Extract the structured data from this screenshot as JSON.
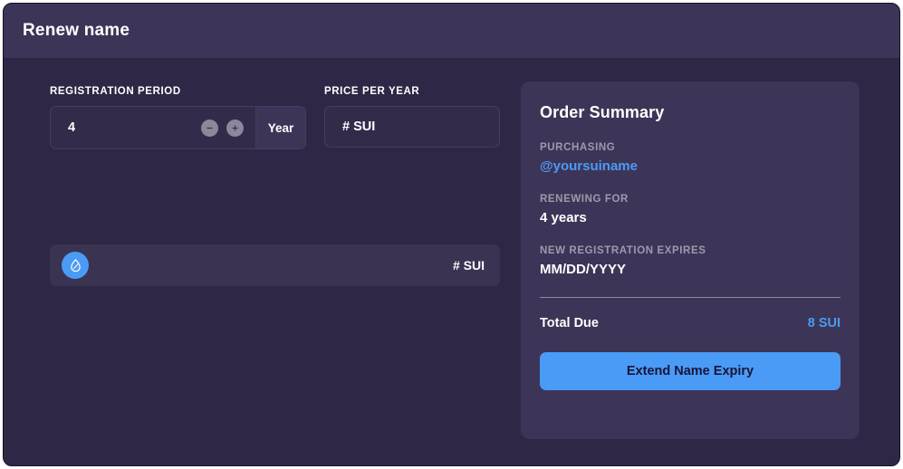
{
  "header": {
    "title": "Renew name"
  },
  "form": {
    "registration_period": {
      "label": "Registration Period",
      "value": "4",
      "unit": "Year",
      "decrement_icon": "minus-circle-icon",
      "increment_icon": "plus-circle-icon"
    },
    "price_per_year": {
      "label": "Price Per Year",
      "value": "# SUI"
    },
    "payment": {
      "coin_icon": "sui-droplet-icon",
      "amount": "# SUI"
    }
  },
  "summary": {
    "title": "Order Summary",
    "rows": [
      {
        "label": "Purchasing",
        "value": "@yoursuiname",
        "style": "link"
      },
      {
        "label": "Renewing For",
        "value": "4 years",
        "style": "plain"
      },
      {
        "label": "New Registration Expires",
        "value": "MM/DD/YYYY",
        "style": "plain"
      }
    ],
    "total_label": "Total Due",
    "total_amount": "8 SUI",
    "cta_label": "Extend Name Expiry"
  },
  "colors": {
    "page_bg": "#2e2746",
    "panel_bg": "#3d3557",
    "input_bg": "#322b4a",
    "accent_blue": "#4a9bf5",
    "label_grey": "#9e99ae",
    "stepper_grey": "#8d879c"
  }
}
